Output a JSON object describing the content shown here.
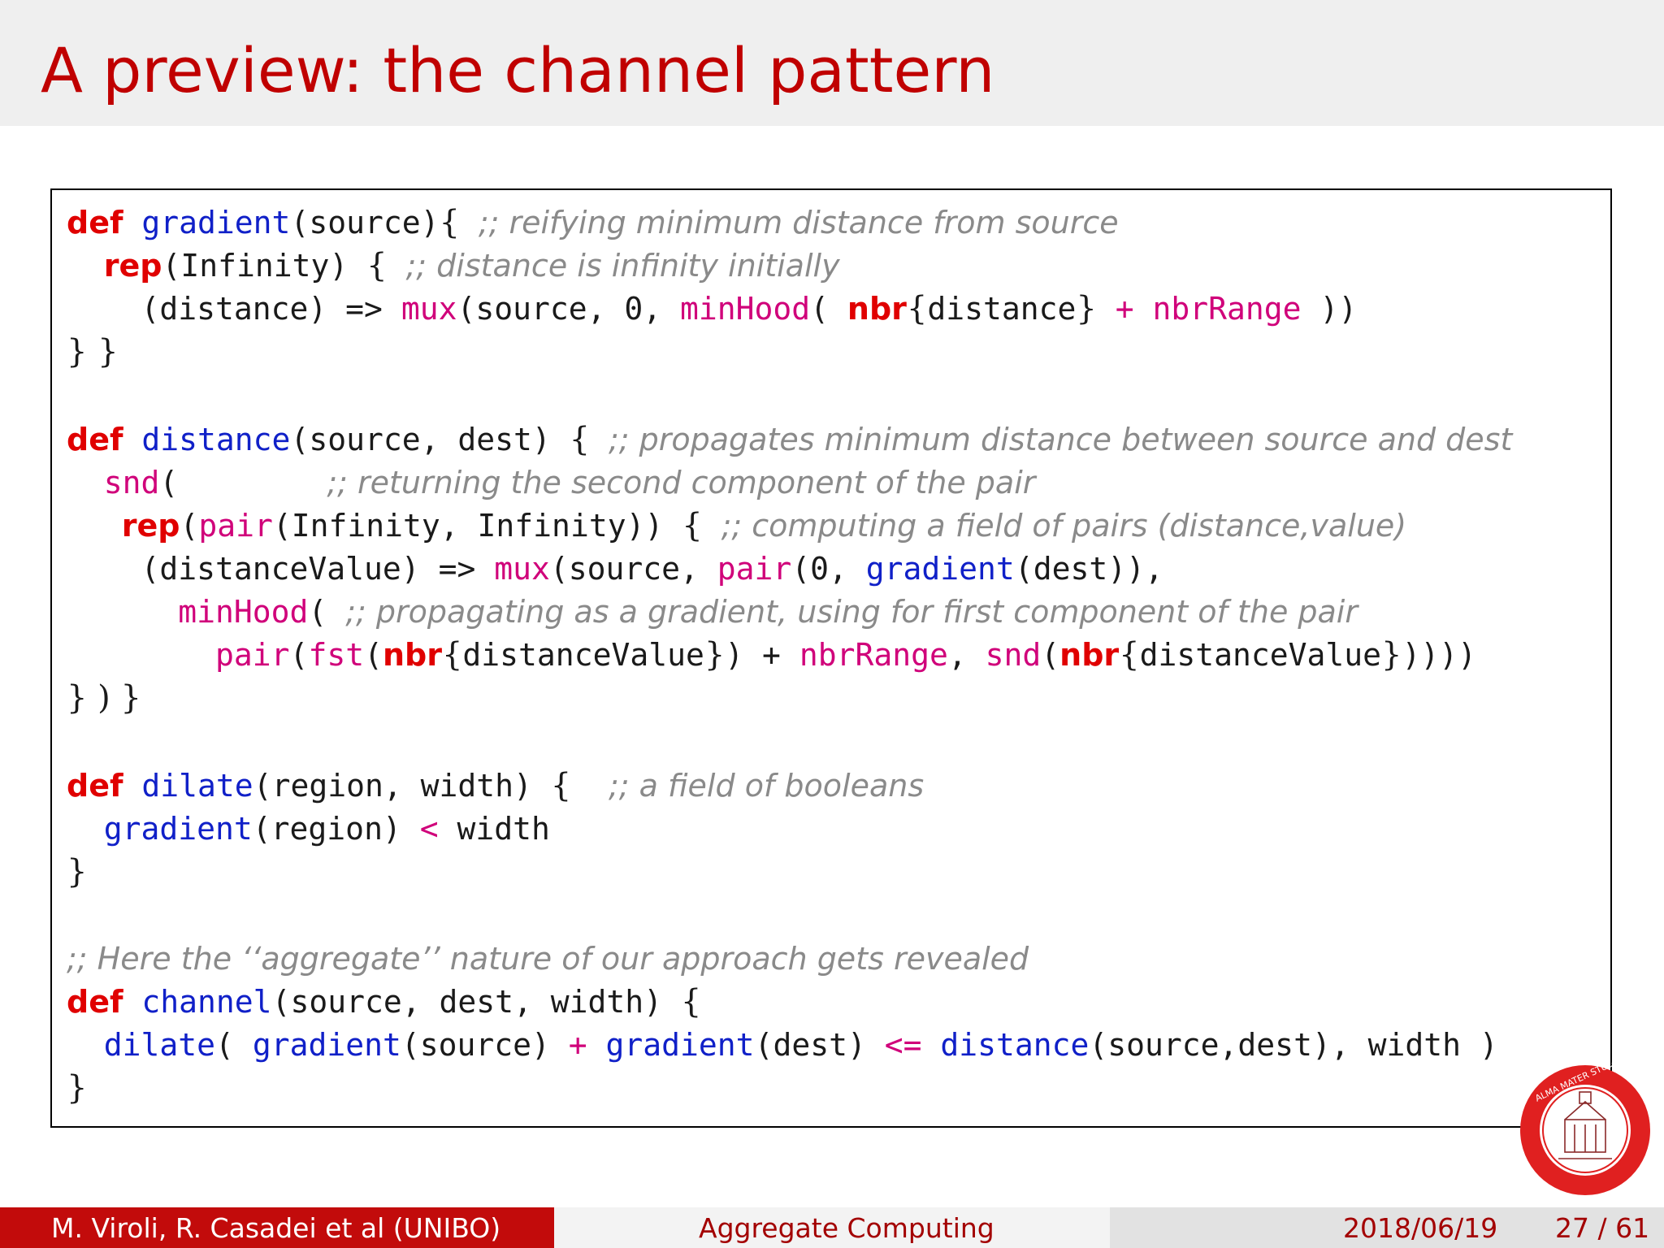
{
  "title": "A preview: the channel pattern",
  "code": {
    "gradient": {
      "def": "def",
      "name": "gradient",
      "sig": "(source)",
      "open_brace": "{",
      "comment": ";; reifying minimum distance from source",
      "rep": "rep",
      "rep_arg": "(Infinity)",
      "rep_brace": "{",
      "rep_comment": ";; distance is infinity initially",
      "body_lambda": "(distance) => ",
      "mux": "mux",
      "mux_args": "(source, 0, ",
      "minHood": "minHood",
      "minHood_open": "( ",
      "nbr": "nbr",
      "nbr_open": "{",
      "nbr_arg": "distance",
      "nbr_close": "}",
      "plus": "+",
      "nbrRange": "nbrRange",
      "closing_parens": " ))",
      "end": "} }"
    },
    "distance": {
      "def": "def",
      "name": "distance",
      "sig": "(source, dest) ",
      "open_brace": "{",
      "comment": ";; propagates minimum distance between source and dest",
      "snd": "snd",
      "snd_open": "(",
      "snd_comment": ";; returning the second component of the pair",
      "rep": "rep",
      "pair": "pair",
      "rep_arg": "(Infinity, Infinity)) ",
      "rep_brace": "{",
      "rep_comment": ";; computing a field of pairs (distance,value)",
      "lambda": "(distanceValue) => ",
      "mux": "mux",
      "mux_args": "(source, ",
      "pair2": "pair",
      "pair2_args": "(0, ",
      "gradient": "gradient",
      "gradient_args": "(dest)),",
      "minHood": "minHood",
      "minHood_open": "( ",
      "minHood_comment": ";; propagating as a gradient, using for first component of the pair",
      "pair3": "pair",
      "fst": "fst",
      "fst_open": "(",
      "nbr1": "nbr",
      "nbr1_open": "{",
      "nbr1_arg": "distanceValue",
      "nbr1_close": "}",
      "after_nbr1": ") + ",
      "nbrRange": "nbrRange",
      "comma": ", ",
      "snd2": "snd",
      "snd2_open": "(",
      "nbr2": "nbr",
      "nbr2_open": "{",
      "nbr2_arg": "distanceValue",
      "nbr2_close": "}",
      "closing": "))))",
      "end": "} ) }"
    },
    "dilate": {
      "def": "def",
      "name": "dilate",
      "sig": "(region, width) ",
      "open_brace": "{",
      "comment": ";; a field of booleans",
      "gradient": "gradient",
      "gradient_args": "(region) ",
      "lt": "<",
      "width": " width",
      "end": "}"
    },
    "channel": {
      "pre_comment": ";; Here the ‘‘aggregate’’ nature of our approach gets revealed",
      "def": "def",
      "name": "channel",
      "sig": "(source, dest, width) ",
      "open_brace": "{",
      "dilate": "dilate",
      "dilate_open": "( ",
      "gradient1": "gradient",
      "gradient1_args": "(source) ",
      "plus": "+",
      "gradient2": "gradient",
      "gradient2_args": "(dest) ",
      "le": "<=",
      "distance": "distance",
      "distance_args": "(source,dest), width )",
      "end": "}"
    }
  },
  "footer": {
    "authors": "M. Viroli, R. Casadei et al  (UNIBO)",
    "course": "Aggregate Computing",
    "date": "2018/06/19",
    "page": "27 / 61"
  },
  "colors": {
    "title": "#c00000",
    "keyword": "#e00000",
    "function": "#1020c8",
    "builtin": "#d0007a",
    "comment": "#8a8a8a",
    "footer_left_bg": "#c20b0b"
  },
  "icons": {
    "seal": "university-seal-logo"
  }
}
